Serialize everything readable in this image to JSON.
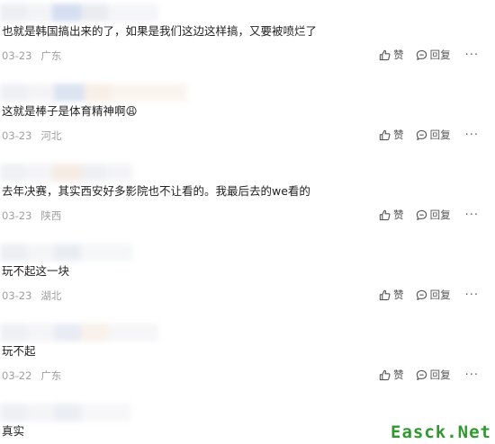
{
  "comments": [
    {
      "text": "也就是韩国搞出来的了，如果是我们这边这样搞，又要被喷烂了",
      "date": "03-23",
      "location": "广东",
      "like_label": "赞",
      "reply_label": "回复",
      "more_label": "···"
    },
    {
      "text": "这就是棒子是体育精神啊",
      "emoji": "😩",
      "date": "03-23",
      "location": "河北",
      "like_label": "赞",
      "reply_label": "回复",
      "more_label": "···"
    },
    {
      "text": "去年决赛，其实西安好多影院也不让看的。我最后去的we看的",
      "date": "03-23",
      "location": "陕西",
      "like_label": "赞",
      "reply_label": "回复",
      "more_label": "···"
    },
    {
      "text": "玩不起这一块",
      "date": "03-23",
      "location": "湖北",
      "like_label": "赞",
      "reply_label": "回复",
      "more_label": "···"
    },
    {
      "text": "玩不起",
      "date": "03-22",
      "location": "广东",
      "like_label": "赞",
      "reply_label": "回复",
      "more_label": "···"
    },
    {
      "text": "真实"
    }
  ],
  "watermark": "Easck.Net",
  "icons": {
    "like": "thumbs-up-icon",
    "reply": "comment-bubble-icon",
    "more": "more-dots-icon"
  },
  "colors": {
    "text": "#222222",
    "meta": "#a0a0a0",
    "action": "#555555",
    "watermark": "#2e9a2e"
  }
}
